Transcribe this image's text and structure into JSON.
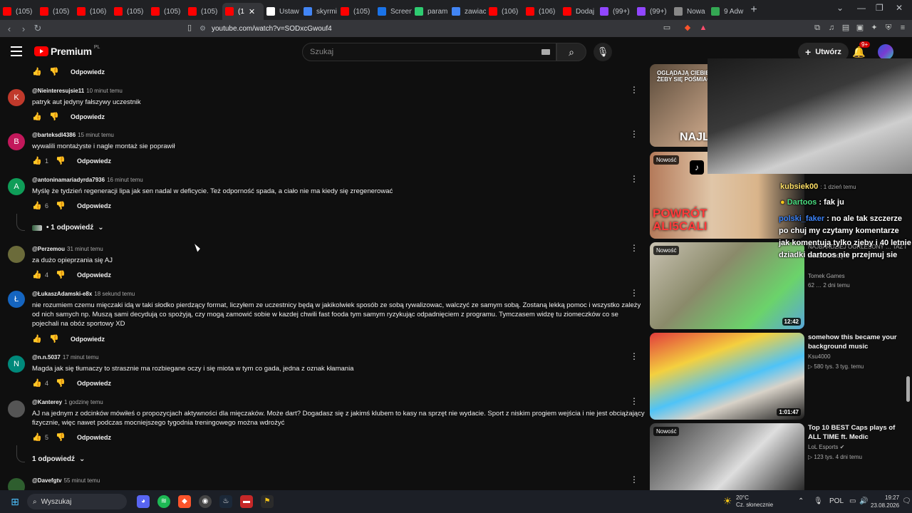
{
  "browser": {
    "tabs": [
      {
        "label": "(105)",
        "icon": "youtube-icon",
        "color": "#ff0000"
      },
      {
        "label": "(105)",
        "icon": "youtube-icon",
        "color": "#ff0000"
      },
      {
        "label": "(106)",
        "icon": "youtube-icon",
        "color": "#ff0000"
      },
      {
        "label": "(105)",
        "icon": "youtube-icon",
        "color": "#ff0000"
      },
      {
        "label": "(105)",
        "icon": "youtube-icon",
        "color": "#ff0000"
      },
      {
        "label": "(105)",
        "icon": "youtube-icon",
        "color": "#ff0000"
      },
      {
        "label": "(1",
        "icon": "youtube-icon",
        "color": "#ff0000",
        "active": true
      },
      {
        "label": "Ustaw",
        "icon": "page-icon",
        "color": "#ffffff"
      },
      {
        "label": "skyrmi",
        "icon": "google-icon",
        "color": "#4285f4"
      },
      {
        "label": "(105)",
        "icon": "youtube-icon",
        "color": "#ff0000"
      },
      {
        "label": "Screen",
        "icon": "screen-icon",
        "color": "#1a73e8"
      },
      {
        "label": "param",
        "icon": "k-icon",
        "color": "#2ecc71"
      },
      {
        "label": "zawiac",
        "icon": "doc-icon",
        "color": "#4285f4"
      },
      {
        "label": "(106)",
        "icon": "youtube-icon",
        "color": "#ff0000"
      },
      {
        "label": "(106)",
        "icon": "youtube-icon",
        "color": "#ff0000"
      },
      {
        "label": "Dodaj",
        "icon": "youtube-icon",
        "color": "#ff0000"
      },
      {
        "label": "(99+)",
        "icon": "twitch-icon",
        "color": "#9146ff"
      },
      {
        "label": "(99+)",
        "icon": "twitch-icon",
        "color": "#9146ff"
      },
      {
        "label": "Nowa",
        "icon": "shield-icon",
        "color": "#888888"
      },
      {
        "label": "9 Adw",
        "icon": "maps-icon",
        "color": "#34a853"
      }
    ],
    "url": "youtube.com/watch?v=SODxcGwouf4"
  },
  "header": {
    "logo_text": "Premium",
    "logo_region": "PL",
    "search_placeholder": "Szukaj",
    "create_label": "Utwórz",
    "notif_badge": "9+"
  },
  "comments": [
    {
      "author": "",
      "time": "",
      "text": "",
      "likes": "",
      "reply_label": "Odpowiedz",
      "avatar_letter": "",
      "only_actions": true
    },
    {
      "author": "@Nieinteresujsie11",
      "time": "10 minut temu",
      "text": "patryk aut jedyny fałszywy uczestnik",
      "likes": "",
      "reply_label": "Odpowiedz",
      "avatar_letter": "K",
      "avatar_color": "#c0392b"
    },
    {
      "author": "@barteksdl4386",
      "time": "15 minut temu",
      "text": "wywalili montażyste i nagle montaż sie poprawił",
      "likes": "1",
      "reply_label": "Odpowiedz",
      "avatar_letter": "B",
      "avatar_color": "#c2185b"
    },
    {
      "author": "@antoninamariadyrda7936",
      "time": "16 minut temu",
      "text": "Myślę że tydzień regeneracji lipa jak sen nadal w deficycie. Też odporność spada, a ciało nie ma kiedy się zregenerować",
      "likes": "6",
      "reply_label": "Odpowiedz",
      "avatar_letter": "A",
      "avatar_color": "#0f9d58",
      "replies_label": "• 1 odpowiedź"
    },
    {
      "author": "@Perzemou",
      "time": "31 minut temu",
      "text": "za dużo opieprzania się AJ",
      "likes": "4",
      "reply_label": "Odpowiedz",
      "avatar_letter": "",
      "avatar_color": "#6b6b3a"
    },
    {
      "author": "@ŁukaszAdamski-e8x",
      "time": "18 sekund temu",
      "text": "nie rozumiem czemu mięczaki idą w taki słodko pierdzący format,  liczyłem ze uczestnicy będą w jakikolwiek sposób ze sobą rywalizowac, walczyć ze samym sobą. Zostaną lekką pomoc i wszystko zależy od nich samych np. Muszą sami decydują co spożyją, czy mogą zamowić sobie w kazdej chwili fast fooda tym samym ryzykując odpadnięciem z programu. Tymczasem widzę tu ziomeczków co se pojechali na obóz sportowy XD",
      "likes": "",
      "reply_label": "Odpowiedz",
      "avatar_letter": "Ł",
      "avatar_color": "#1565c0"
    },
    {
      "author": "@n.n.5037",
      "time": "17 minut temu",
      "text": "Magda jak się tłumaczy to strasznie ma rozbiegane oczy i się miota w tym co gada, jedna z oznak kłamania",
      "likes": "4",
      "reply_label": "Odpowiedz",
      "avatar_letter": "N",
      "avatar_color": "#00897b"
    },
    {
      "author": "@Kanterey",
      "time": "1 godzinę temu",
      "text": "AJ na jednym z odcinków mówiłeś o propozycjach aktywności dla mięczaków. Może dart? Dogadasz się z jakimś klubem to kasy na sprzęt nie wydacie. Sport z niskim progiem wejścia i nie jest obciążający fizycznie, więc nawet podczas mocniejszego tygodnia treningowego można wdrożyć",
      "likes": "5",
      "reply_label": "Odpowiedz",
      "avatar_letter": "",
      "avatar_color": "#555555",
      "replies_label": "1 odpowiedź"
    },
    {
      "author": "@Davefgtv",
      "time": "55 minut temu",
      "text": "",
      "likes": "",
      "reply_label": "",
      "avatar_letter": "",
      "avatar_color": "#2e5e2e"
    }
  ],
  "sidebar": [
    {
      "title": "",
      "channel": "",
      "meta": "",
      "duration": "",
      "new_label": "",
      "thumb_text": "NAJLEP"
    },
    {
      "title": "",
      "channel": "",
      "meta": "",
      "duration": "",
      "new_label": "Nowość",
      "thumb_text": "POWRÓT ALI5CALI"
    },
    {
      "title": "NAJBARDZIEJ OGRLESONY … TAŻ I MINIATURKĘ ...",
      "channel": "Tomek Games",
      "meta": "62 … 2 dni temu",
      "duration": "12:42",
      "new_label": "Nowość",
      "thumb_text": ""
    },
    {
      "title": "somehow this became your background music",
      "channel": "Ksu4000",
      "meta": "▷ 580 tys.  3 tyg. temu",
      "duration": "1:01:47",
      "new_label": "",
      "thumb_text": ""
    },
    {
      "title": "Top 10 BEST Caps plays of ALL TIME ft. Medic",
      "channel": "LoL Esports",
      "meta": "▷ 123 tys.  4 dni temu",
      "duration": "",
      "new_label": "Nowość",
      "thumb_text": ""
    }
  ],
  "overlay_chat": {
    "user1": "kubsiek00",
    "user1_suffix": ": 1 dzień temu",
    "user2": "Dartoos",
    "msg2": ": fak ju",
    "user3": "polski_faker",
    "msg3": ": no ale tak szczerze po chuj my czytamy komentarze jak komentują tylko zjeby i 40 letnie dziadki dartoos nie przejmuj sie",
    "user4": "",
    "msg4": ":"
  },
  "taskbar": {
    "search_label": "Wyszukaj",
    "weather_temp": "20°C",
    "weather_desc": "Cz. słonecznie",
    "lang": "POL",
    "time": "19:27",
    "date": "23.08.2026"
  }
}
